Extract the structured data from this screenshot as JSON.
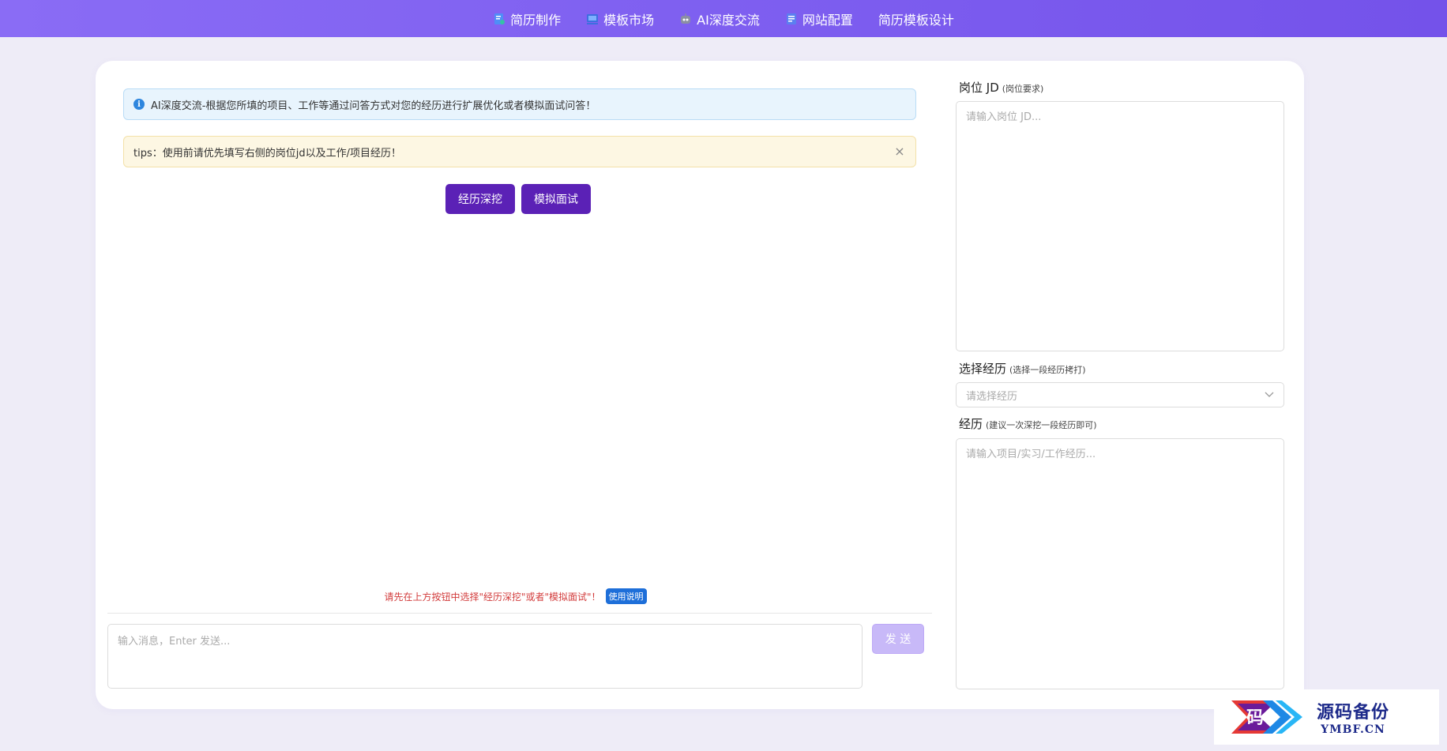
{
  "nav": {
    "items": [
      {
        "label": "简历制作",
        "icon": "resume-icon"
      },
      {
        "label": "模板市场",
        "icon": "template-market-icon"
      },
      {
        "label": "AI深度交流",
        "icon": "robot-icon"
      },
      {
        "label": "网站配置",
        "icon": "settings-doc-icon"
      },
      {
        "label": "简历模板设计",
        "icon": ""
      }
    ]
  },
  "chat": {
    "info_alert": "AI深度交流-根据您所填的项目、工作等通过问答方式对您的经历进行扩展优化或者模拟面试问答！",
    "tips_alert": "tips：使用前请优先填写右侧的岗位jd以及工作/项目经历！",
    "buttons": {
      "deep_dig": "经历深挖",
      "mock_interview": "模拟面试"
    },
    "hint": "请先在上方按钮中选择\"经历深挖\"或者\"模拟面试\"！",
    "help_label": "使用说明",
    "input_placeholder": "输入消息，Enter 发送...",
    "send_label": "发 送"
  },
  "side": {
    "jd": {
      "label": "岗位 JD",
      "sublabel": "(岗位要求)",
      "placeholder": "请输入岗位 JD..."
    },
    "select_exp": {
      "label": "选择经历",
      "sublabel": "(选择一段经历拷打)",
      "placeholder": "请选择经历"
    },
    "experience": {
      "label": "经历",
      "sublabel": "(建议一次深挖一段经历即可)",
      "placeholder": "请输入项目/实习/工作经历..."
    }
  },
  "watermark": {
    "cn": "源码备份",
    "en": "YMBF.CN",
    "logo_char": "码"
  },
  "colors": {
    "nav_gradient_start": "#8a6cf5",
    "primary_button": "#5b21b6",
    "send_button_disabled": "#c8b9f8",
    "hint_red": "#d23b3b",
    "help_badge": "#1e6fd9"
  }
}
